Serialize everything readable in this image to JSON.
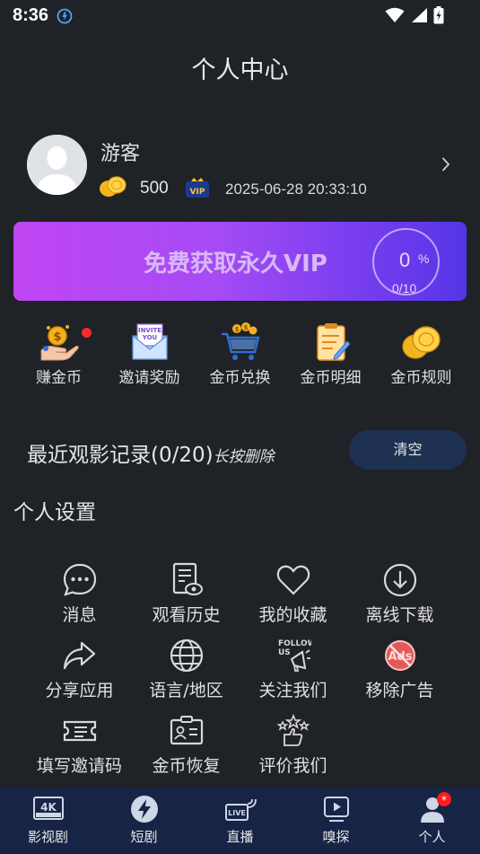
{
  "status_bar": {
    "time": "8:36"
  },
  "page_title": "个人中心",
  "profile": {
    "username": "游客",
    "coins": "500",
    "vip_expiry": "2025-06-28 20:33:10"
  },
  "vip_banner": {
    "text": "免费获取永久VIP",
    "percent": "0",
    "percent_sign": "%",
    "progress": "0/10",
    "progress_fraction": 0
  },
  "quick_actions": [
    {
      "label": "赚金币",
      "icon": "earn-coins-icon"
    },
    {
      "label": "邀请奖励",
      "icon": "invite-you-icon"
    },
    {
      "label": "金币兑换",
      "icon": "coin-cart-icon"
    },
    {
      "label": "金币明细",
      "icon": "coin-details-icon"
    },
    {
      "label": "金币规则",
      "icon": "coin-rules-icon"
    }
  ],
  "recent": {
    "title": "最近观影记录(0/20)",
    "hint": "长按删除",
    "clear_label": "清空"
  },
  "settings": {
    "title": "个人设置",
    "items": [
      {
        "label": "消息",
        "icon": "message-icon"
      },
      {
        "label": "观看历史",
        "icon": "watch-history-icon"
      },
      {
        "label": "我的收藏",
        "icon": "heart-icon"
      },
      {
        "label": "离线下载",
        "icon": "download-icon"
      },
      {
        "label": "分享应用",
        "icon": "share-icon"
      },
      {
        "label": "语言/地区",
        "icon": "globe-icon"
      },
      {
        "label": "关注我们",
        "icon": "follow-us-icon"
      },
      {
        "label": "移除广告",
        "icon": "no-ads-icon"
      },
      {
        "label": "填写邀请码",
        "icon": "ticket-icon"
      },
      {
        "label": "金币恢复",
        "icon": "id-card-icon"
      },
      {
        "label": "评价我们",
        "icon": "rate-stars-icon"
      }
    ]
  },
  "bottom_nav": {
    "items": [
      {
        "label": "影视剧",
        "icon": "4k-icon"
      },
      {
        "label": "短剧",
        "icon": "lightning-icon"
      },
      {
        "label": "直播",
        "icon": "live-icon"
      },
      {
        "label": "嗅探",
        "icon": "play-icon"
      },
      {
        "label": "个人",
        "icon": "user-icon"
      }
    ],
    "badge": "*"
  },
  "colors": {
    "background": "#1f2226",
    "nav_background": "#172445",
    "clear_button": "#1e3152",
    "vip_gradient_start": "#c045f3",
    "vip_gradient_end": "#5436e6",
    "badge_red": "#ff1b1b"
  }
}
